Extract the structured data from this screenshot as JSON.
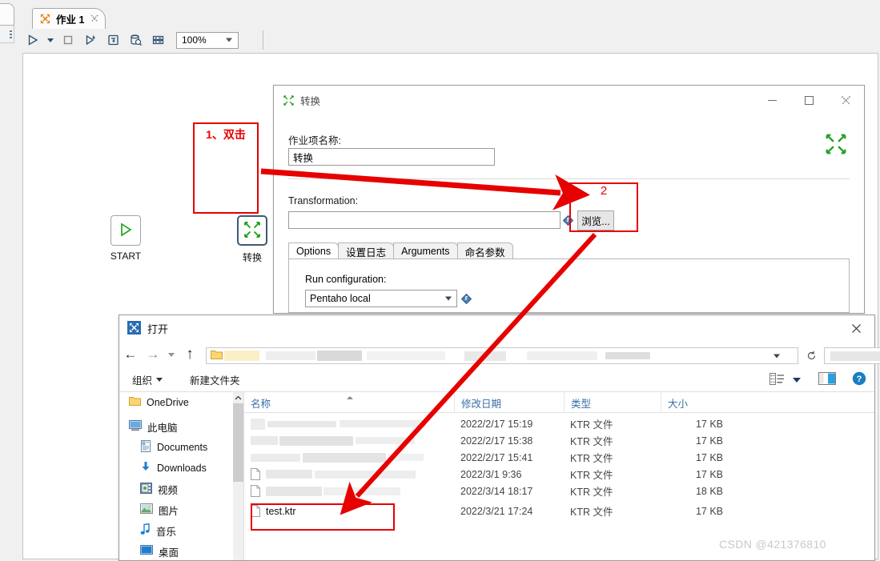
{
  "app": {
    "tab": {
      "label": "作业 1",
      "icon": "kettle-job-icon",
      "close": "✕"
    },
    "toolbar": {
      "run": "run-icon",
      "run_dropdown": "chevron-down-icon",
      "stop": "stop-icon",
      "preview": "preview-icon",
      "debug": "debug-icon",
      "inspect": "inspect-data-icon",
      "grid": "grid-icon",
      "zoom_value": "100%"
    }
  },
  "canvas": {
    "nodes": [
      {
        "id": "start",
        "label": "START",
        "icon": "play-triangle-icon"
      },
      {
        "id": "transformation",
        "label": "转换",
        "icon": "transformation-arrows-icon"
      }
    ],
    "annotations": [
      {
        "id": "step1",
        "label": "1、双击"
      },
      {
        "id": "step2",
        "label": "2"
      }
    ]
  },
  "trans_dialog": {
    "title": "转换",
    "icon": "transformation-arrows-icon",
    "window_buttons": {
      "minimize": "minimize-icon",
      "maximize": "maximize-icon",
      "close": "close-icon"
    },
    "job_name_label": "作业项名称:",
    "job_name_value": "转换",
    "transformation_label": "Transformation:",
    "transformation_value": "",
    "browse_label": "浏览...",
    "tabs": [
      {
        "label": "Options",
        "active": true
      },
      {
        "label": "设置日志",
        "active": false
      },
      {
        "label": "Arguments",
        "active": false
      },
      {
        "label": "命名参数",
        "active": false
      }
    ],
    "run_config_label": "Run configuration:",
    "run_config_value": "Pentaho local"
  },
  "open_dialog": {
    "title": "打开",
    "icon": "kettle-app-icon",
    "close": "✕",
    "nav": {
      "back": "arrow-left-icon",
      "forward": "arrow-right-icon",
      "history": "chevron-down-icon",
      "up": "arrow-up-icon"
    },
    "path_value": "",
    "path_icon": "folder-icon",
    "refresh": "refresh-icon",
    "search_value": "",
    "search_icon": "search-icon",
    "commands": [
      {
        "label": "组织",
        "has_caret": true
      },
      {
        "label": "新建文件夹",
        "has_caret": false
      }
    ],
    "view_tools": {
      "view_mode": "list-view-icon",
      "view_caret": "chevron-down-icon",
      "preview_pane": "preview-pane-icon",
      "help": "help-icon"
    },
    "sidebar": [
      {
        "label": "OneDrive",
        "icon": "folder-icon",
        "indent": false
      },
      {
        "label": "此电脑",
        "icon": "this-pc-icon",
        "indent": false
      },
      {
        "label": "Documents",
        "icon": "documents-icon",
        "indent": true
      },
      {
        "label": "Downloads",
        "icon": "downloads-icon",
        "indent": true
      },
      {
        "label": "视频",
        "icon": "videos-icon",
        "indent": true
      },
      {
        "label": "图片",
        "icon": "pictures-icon",
        "indent": true
      },
      {
        "label": "音乐",
        "icon": "music-icon",
        "indent": true
      },
      {
        "label": "桌面",
        "icon": "desktop-icon",
        "indent": true
      }
    ],
    "columns": [
      "名称",
      "修改日期",
      "类型",
      "大小"
    ],
    "files": [
      {
        "name": "",
        "redacted": true,
        "modified": "2022/2/17 15:19",
        "type": "KTR 文件",
        "size": "17 KB",
        "selected": false
      },
      {
        "name": "",
        "redacted": true,
        "modified": "2022/2/17 15:38",
        "type": "KTR 文件",
        "size": "17 KB",
        "selected": false
      },
      {
        "name": "",
        "redacted": true,
        "modified": "2022/2/17 15:41",
        "type": "KTR 文件",
        "size": "17 KB",
        "selected": false
      },
      {
        "name": "",
        "redacted": true,
        "modified": "2022/3/1 9:36",
        "type": "KTR 文件",
        "size": "17 KB",
        "selected": false
      },
      {
        "name": "",
        "redacted": true,
        "modified": "2022/3/14 18:17",
        "type": "KTR 文件",
        "size": "18 KB",
        "selected": false
      },
      {
        "name": "test.ktr",
        "redacted": false,
        "modified": "2022/3/21 17:24",
        "type": "KTR 文件",
        "size": "17 KB",
        "selected": true
      }
    ]
  },
  "watermark": "CSDN @421376810",
  "colors": {
    "annotation_red": "#e60000",
    "accent_blue": "#2b4d6f",
    "link_blue": "#3a6ea5",
    "green": "#13a10e"
  }
}
